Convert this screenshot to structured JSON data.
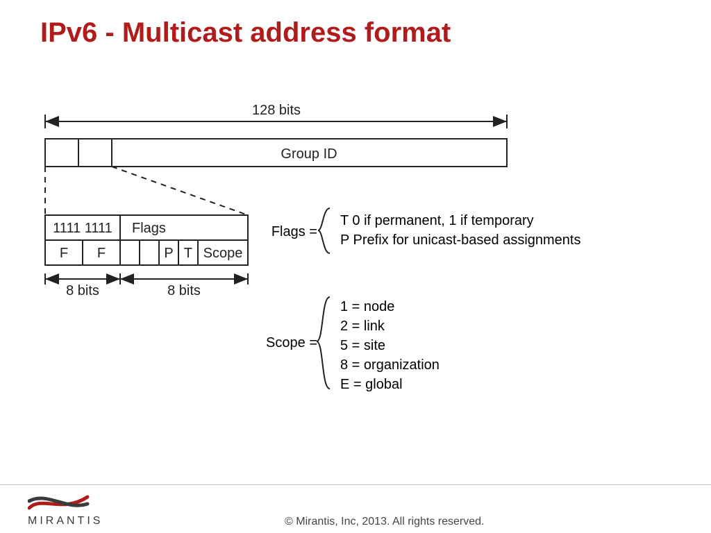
{
  "title": "IPv6 - Multicast address format",
  "diagram": {
    "total_width_label": "128 bits",
    "top_bar": {
      "seg3_label": "Group ID"
    },
    "detail": {
      "row1": {
        "prefix_bits": "1111 1111",
        "flags_label": "Flags"
      },
      "row2": {
        "f1": "F",
        "f2": "F",
        "p": "P",
        "t": "T",
        "scope": "Scope"
      },
      "width_left": "8 bits",
      "width_right": "8 bits"
    },
    "flags_def": {
      "label": "Flags =",
      "lines": [
        "T 0 if permanent, 1 if temporary",
        "P Prefix for unicast-based assignments"
      ]
    },
    "scope_def": {
      "label": "Scope =",
      "lines": [
        "1 = node",
        "2 = link",
        "5 = site",
        "8 = organization",
        "E = global"
      ]
    }
  },
  "footer": {
    "brand": "MIRANTIS",
    "copyright": "© Mirantis, Inc, 2013. All rights reserved."
  }
}
